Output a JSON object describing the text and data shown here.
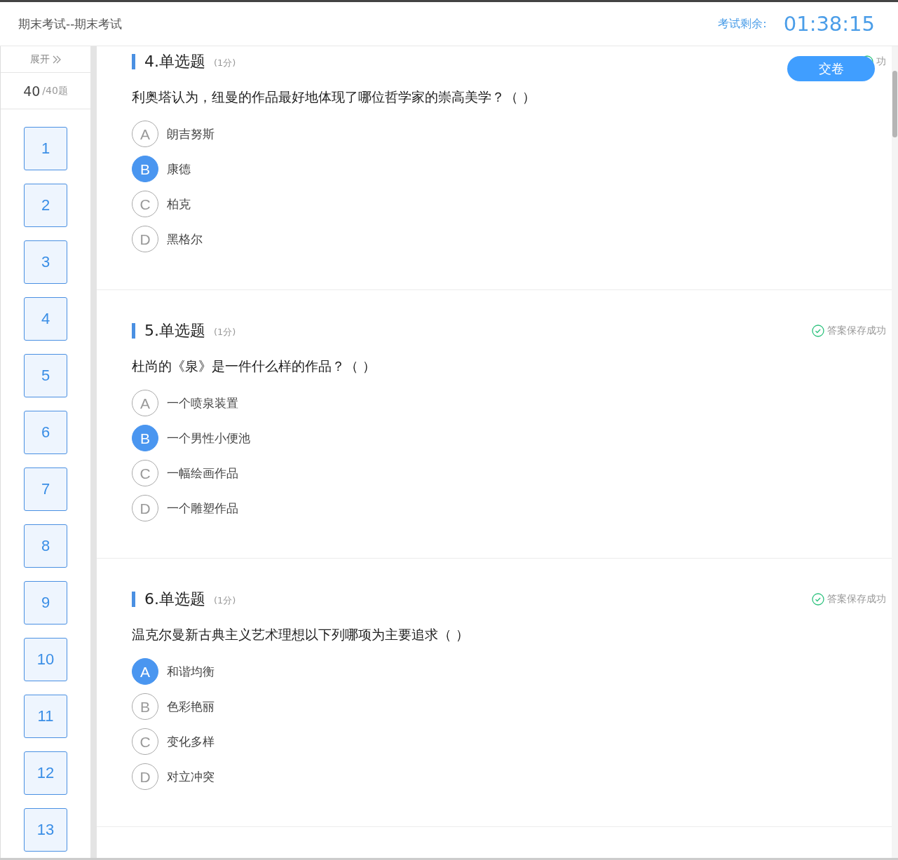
{
  "header": {
    "title": "期末考试--期末考试",
    "timer_label": "考试剩余:",
    "timer": "01:38:15"
  },
  "sidebar": {
    "expand": "展开",
    "answered": "40",
    "total": "/40题",
    "questions": [
      {
        "number": "1"
      },
      {
        "number": "2"
      },
      {
        "number": "3"
      },
      {
        "number": "4"
      },
      {
        "number": "5"
      },
      {
        "number": "6"
      },
      {
        "number": "7"
      },
      {
        "number": "8"
      },
      {
        "number": "9"
      },
      {
        "number": "10"
      },
      {
        "number": "11"
      },
      {
        "number": "12"
      },
      {
        "number": "13"
      }
    ]
  },
  "submit_button": "交卷",
  "questions": [
    {
      "title": "4.单选题",
      "score": "(1分)",
      "save_status": "功",
      "text": "利奥塔认为，纽曼的作品最好地体现了哪位哲学家的崇高美学？（ ）",
      "options": [
        {
          "letter": "A",
          "text": "朗吉努斯",
          "selected": false
        },
        {
          "letter": "B",
          "text": "康德",
          "selected": true
        },
        {
          "letter": "C",
          "text": "柏克",
          "selected": false
        },
        {
          "letter": "D",
          "text": "黑格尔",
          "selected": false
        }
      ]
    },
    {
      "title": "5.单选题",
      "score": "(1分)",
      "save_status": "答案保存成功",
      "text": "杜尚的《泉》是一件什么样的作品？（ ）",
      "options": [
        {
          "letter": "A",
          "text": "一个喷泉装置",
          "selected": false
        },
        {
          "letter": "B",
          "text": "一个男性小便池",
          "selected": true
        },
        {
          "letter": "C",
          "text": "一幅绘画作品",
          "selected": false
        },
        {
          "letter": "D",
          "text": "一个雕塑作品",
          "selected": false
        }
      ]
    },
    {
      "title": "6.单选题",
      "score": "(1分)",
      "save_status": "答案保存成功",
      "text": "温克尔曼新古典主义艺术理想以下列哪项为主要追求（ ）",
      "options": [
        {
          "letter": "A",
          "text": "和谐均衡",
          "selected": true
        },
        {
          "letter": "B",
          "text": "色彩艳丽",
          "selected": false
        },
        {
          "letter": "C",
          "text": "变化多样",
          "selected": false
        },
        {
          "letter": "D",
          "text": "对立冲突",
          "selected": false
        }
      ]
    }
  ]
}
